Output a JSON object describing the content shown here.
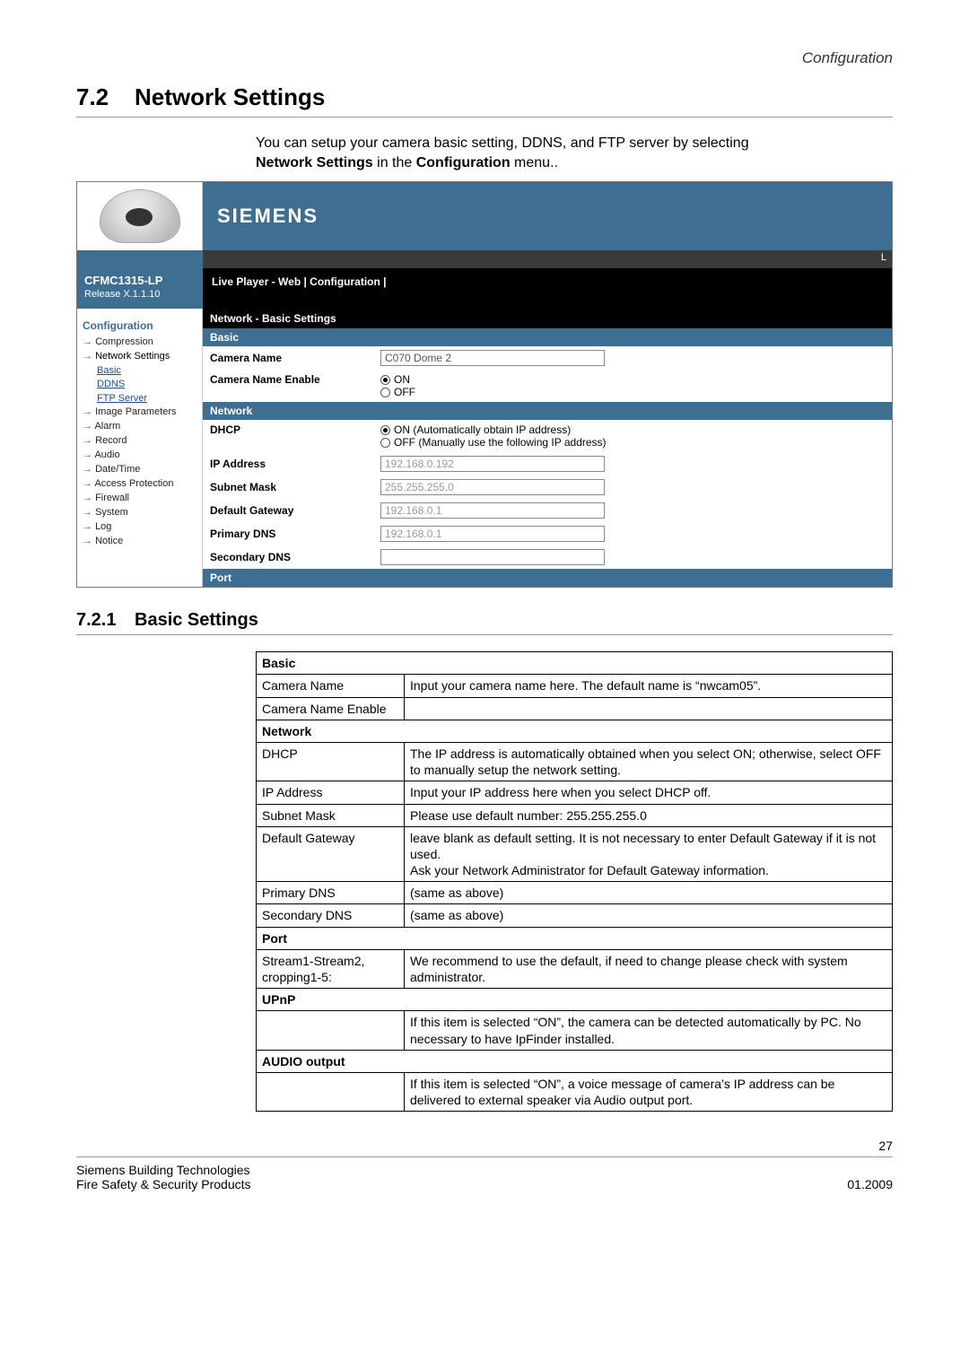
{
  "header": {
    "breadcrumb": "Configuration"
  },
  "section": {
    "number": "7.2",
    "title": "Network Settings"
  },
  "intro": {
    "line1": "You can setup your camera basic setting, DDNS, and FTP server by selecting",
    "bold1": "Network Settings",
    "mid": " in the ",
    "bold2": "Configuration",
    "tail": " menu.."
  },
  "screenshot": {
    "brand": "SIEMENS",
    "status_right": "L",
    "model": "CFMC1315-LP",
    "release": "Release X.1.1.10",
    "breadcrumb": "Live Player - Web  |  Configuration  |",
    "sidebar": {
      "cfg": "Configuration",
      "items": [
        "Compression",
        "Network Settings",
        "Image Parameters",
        "Alarm",
        "Record",
        "Audio",
        "Date/Time",
        "Access Protection",
        "Firewall",
        "System",
        "Log",
        "Notice"
      ],
      "subitems": [
        "Basic",
        "DDNS",
        "FTP Server"
      ]
    },
    "content": {
      "title": "Network - Basic Settings",
      "sections": {
        "basic": {
          "bar": "Basic",
          "camera_name_label": "Camera Name",
          "camera_name_value": "C070 Dome 2",
          "camera_name_enable_label": "Camera Name Enable",
          "on": "ON",
          "off": "OFF"
        },
        "network": {
          "bar": "Network",
          "dhcp_label": "DHCP",
          "dhcp_on": "ON   (Automatically obtain IP address)",
          "dhcp_off": "OFF  (Manually use the following IP address)",
          "ip_label": "IP Address",
          "ip_value": "192.168.0.192",
          "subnet_label": "Subnet Mask",
          "subnet_value": "255.255.255.0",
          "gw_label": "Default Gateway",
          "gw_value": "192.168.0.1",
          "pdns_label": "Primary DNS",
          "pdns_value": "192.168.0.1",
          "sdns_label": "Secondary DNS",
          "sdns_value": ""
        },
        "port": {
          "bar": "Port"
        }
      }
    }
  },
  "subsection": {
    "number": "7.2.1",
    "title": "Basic Settings"
  },
  "desc_table": {
    "groups": [
      {
        "head": "Basic",
        "rows": [
          {
            "a": "Camera Name",
            "b": "Input your camera name here. The default name is “nwcam05”."
          },
          {
            "a": "Camera Name Enable",
            "b": ""
          }
        ]
      },
      {
        "head": "Network",
        "rows": [
          {
            "a": "DHCP",
            "b": "The IP address is automatically obtained when you select ON; otherwise, select OFF to manually setup the network setting."
          },
          {
            "a": "IP Address",
            "b": "Input your IP address here when you select DHCP off."
          },
          {
            "a": "Subnet Mask",
            "b": "Please use default number: 255.255.255.0"
          },
          {
            "a": "Default Gateway",
            "b": "leave blank as default setting. It is not necessary to enter Default Gateway if it is not used.\nAsk your Network Administrator for Default Gateway information."
          },
          {
            "a": "Primary DNS",
            "b": "(same as above)"
          },
          {
            "a": "Secondary DNS",
            "b": "(same as above)"
          }
        ]
      },
      {
        "head": "Port",
        "rows": [
          {
            "a": "Stream1-Stream2, cropping1-5:",
            "b": "We recommend to use the default, if need to change please check with system administrator."
          }
        ]
      },
      {
        "head": "UPnP",
        "rows": [
          {
            "a": "",
            "b": "If this item is selected “ON”, the camera can be detected automatically by PC. No necessary to have IpFinder installed."
          }
        ]
      },
      {
        "head": "AUDIO output",
        "rows": [
          {
            "a": "",
            "b": "If this item is selected “ON”, a voice message of camera’s IP address can be delivered to external speaker via Audio output port."
          }
        ]
      }
    ]
  },
  "footer": {
    "page": "27",
    "left1": "Siemens Building Technologies",
    "left2": "Fire Safety & Security Products",
    "right": "01.2009"
  }
}
